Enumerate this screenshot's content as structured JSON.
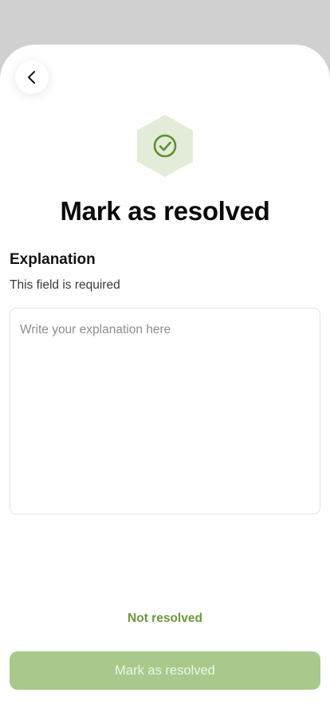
{
  "header": {
    "back_icon": "chevron-left-icon",
    "status_icon": "check-circle-icon"
  },
  "main": {
    "title": "Mark as resolved",
    "field": {
      "label": "Explanation",
      "helper": "This field is required",
      "value": "",
      "placeholder": "Write your explanation here"
    },
    "status_text": "Not resolved",
    "submit_label": "Mark as resolved"
  },
  "colors": {
    "accent": "#6a9a3b",
    "icon_bg": "#e3ecd8",
    "button_bg": "#a8c98b",
    "overlay_bg": "#d0d0d0"
  }
}
